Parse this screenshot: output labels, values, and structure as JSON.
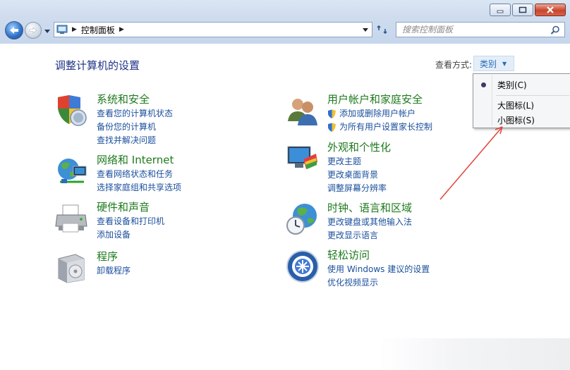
{
  "window": {
    "minimize_label": "",
    "maximize_label": "",
    "close_label": ""
  },
  "address": {
    "path": "控制面板"
  },
  "search": {
    "placeholder": "搜索控制面板"
  },
  "page": {
    "title": "调整计算机的设置",
    "viewby_label": "查看方式:",
    "viewby_value": "类别"
  },
  "categories": [
    {
      "title": "系统和安全",
      "icon": "shield-icon",
      "links": [
        "查看您的计算机状态",
        "备份您的计算机",
        "查找并解决问题"
      ]
    },
    {
      "title": "网络和 Internet",
      "icon": "network-globe-icon",
      "links": [
        "查看网络状态和任务",
        "选择家庭组和共享选项"
      ]
    },
    {
      "title": "硬件和声音",
      "icon": "printer-icon",
      "links": [
        "查看设备和打印机",
        "添加设备"
      ]
    },
    {
      "title": "程序",
      "icon": "programs-box-icon",
      "links": [
        "卸载程序"
      ]
    },
    {
      "title": "用户帐户和家庭安全",
      "icon": "users-icon",
      "links": [
        "添加或删除用户帐户",
        "为所有用户设置家长控制"
      ]
    },
    {
      "title": "外观和个性化",
      "icon": "monitor-palette-icon",
      "links": [
        "更改主题",
        "更改桌面背景",
        "调整屏幕分辨率"
      ]
    },
    {
      "title": "时钟、语言和区域",
      "icon": "globe-clock-icon",
      "links": [
        "更改键盘或其他输入法",
        "更改显示语言"
      ]
    },
    {
      "title": "轻松访问",
      "icon": "ease-of-access-icon",
      "links": [
        "使用 Windows 建议的设置",
        "优化视频显示"
      ]
    }
  ],
  "viewby_menu": {
    "items": [
      "类别(C)",
      "大图标(L)",
      "小图标(S)"
    ],
    "selected": "类别(C)"
  },
  "colors": {
    "category_title": "#1e7a1e",
    "link": "#1a4f9c",
    "page_title": "#1e3287",
    "annotation_arrow": "#e0443c"
  }
}
